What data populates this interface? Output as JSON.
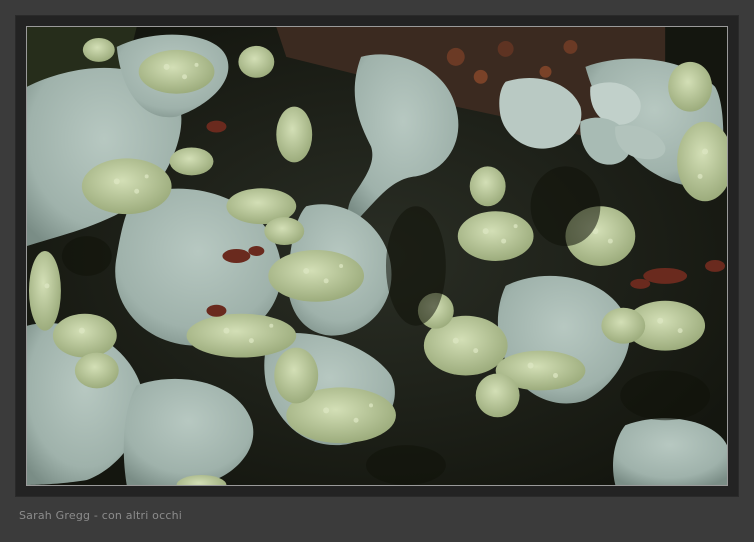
{
  "caption": {
    "text": "Sarah Gregg - con altri occhi"
  },
  "photo": {
    "subject": "foliose-lichen-closeup",
    "colors": {
      "background": "#1d201c",
      "thallus": "#a9bbb4",
      "thallus_shadow": "#7e918b",
      "soredia": "#c6d3a7",
      "soredia_shadow": "#9aa97e",
      "bark": "#4a2a1e",
      "moss": "#2e3520"
    }
  }
}
